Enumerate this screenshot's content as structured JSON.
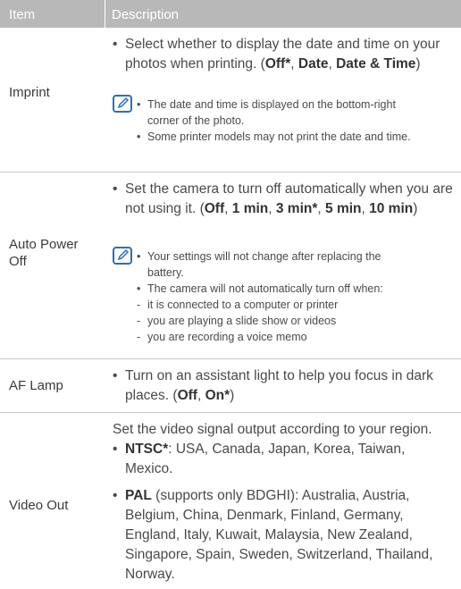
{
  "header": {
    "item": "Item",
    "description": "Description"
  },
  "imprint": {
    "label": "Imprint",
    "text": "Select whether to display the date and time on your photos when printing. (",
    "opt1": "Off*",
    "sep1": ", ",
    "opt2": "Date",
    "sep2": ", ",
    "opt3": "Date & Time",
    "close": ")",
    "note1": "The date and time is displayed on the bottom-right corner of the photo.",
    "note2": "Some printer models may not print the date and time."
  },
  "autopower": {
    "label": "Auto Power Off",
    "text": "Set the camera to turn off automatically when you are not using it. (",
    "opt1": "Off",
    "sep1": ", ",
    "opt2": "1 min",
    "sep2": ", ",
    "opt3": "3 min*",
    "sep3": ", ",
    "opt4": "5 min",
    "sep4": ", ",
    "opt5": "10 min",
    "close": ")",
    "note1": "Your settings will not change after replacing the battery.",
    "note2": "The camera will not automatically turn off when:",
    "sub1": "it is connected to a computer or printer",
    "sub2": "you are playing a slide show or videos",
    "sub3": "you are recording a voice memo"
  },
  "aflamp": {
    "label": "AF Lamp",
    "text": "Turn on an assistant light to help you focus in dark places. (",
    "opt1": "Off",
    "sep1": ", ",
    "opt2": "On*",
    "close": ")"
  },
  "videoout": {
    "label": "Video Out",
    "intro": "Set the video signal output according to your region.",
    "ntsc_name": "NTSC*",
    "ntsc_text": ": USA, Canada, Japan, Korea, Taiwan, Mexico.",
    "pal_name": "PAL",
    "pal_text": " (supports only BDGHI): Australia, Austria, Belgium, China, Denmark, Finland, Germany, England, Italy, Kuwait, Malaysia, New Zealand, Singapore, Spain, Sweden, Switzerland, Thailand, Norway."
  },
  "icon": "note-pencil-icon",
  "colors": {
    "header_bg": "#b8b8b8",
    "header_text": "#ffffff",
    "divider": "#c8c8c8",
    "icon": "#2f6fb0"
  }
}
